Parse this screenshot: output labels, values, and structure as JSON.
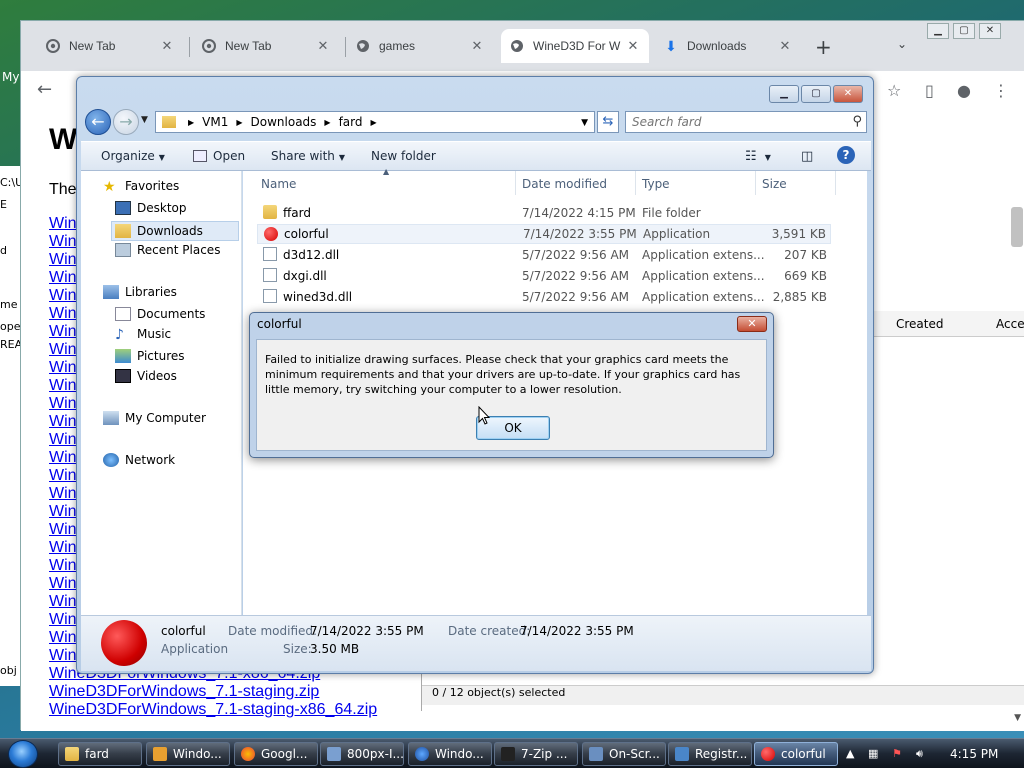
{
  "desktop": {
    "icon_label": "My",
    "left_strip": [
      "C:\\U",
      "E",
      "d",
      "me",
      "oper",
      "REA",
      "obj"
    ]
  },
  "chrome": {
    "tabs": [
      {
        "label": "New Tab",
        "icon": "chrome-icon"
      },
      {
        "label": "New Tab",
        "icon": "chrome-icon"
      },
      {
        "label": "games",
        "icon": "globe-icon"
      },
      {
        "label": "WineD3D For W",
        "icon": "globe-icon"
      },
      {
        "label": "Downloads",
        "icon": "download-icon"
      }
    ],
    "new_tab": "+",
    "page": {
      "heading": "W",
      "intro": "The",
      "links": [
        "Wine",
        "Wine",
        "Wine",
        "Wine",
        "Win",
        "Win",
        "Win",
        "Win",
        "Win",
        "Win",
        "Win",
        "Win",
        "Win",
        "Win",
        "Win",
        "Win",
        "Win",
        "Win",
        "Win",
        "Win",
        "Win",
        "Win",
        "Win",
        "Win",
        "Win"
      ],
      "full_links": [
        "WineD3DForWindows_7.1-x86_64.zip",
        "WineD3DForWindows_7.1-staging.zip",
        "WineD3DForWindows_7.1-staging-x86_64.zip"
      ]
    }
  },
  "zip": {
    "headers": [
      "Created",
      "Accessed"
    ],
    "status": "0 / 12 object(s) selected"
  },
  "explorer": {
    "breadcrumb": [
      "VM1",
      "Downloads",
      "fard"
    ],
    "search_placeholder": "Search fard",
    "commands": {
      "organize": "Organize",
      "open": "Open",
      "share": "Share with",
      "new_folder": "New folder"
    },
    "nav": {
      "favorites": "Favorites",
      "desktop": "Desktop",
      "downloads": "Downloads",
      "recent": "Recent Places",
      "libraries": "Libraries",
      "documents": "Documents",
      "music": "Music",
      "pictures": "Pictures",
      "videos": "Videos",
      "computer": "My Computer",
      "network": "Network"
    },
    "columns": {
      "name": "Name",
      "date": "Date modified",
      "type": "Type",
      "size": "Size"
    },
    "files": [
      {
        "name": "ffard",
        "date": "7/14/2022 4:15 PM",
        "type": "File folder",
        "size": "",
        "icon": "folder-icon"
      },
      {
        "name": "colorful",
        "date": "7/14/2022 3:55 PM",
        "type": "Application",
        "size": "3,591 KB",
        "icon": "red-circle-icon"
      },
      {
        "name": "d3d12.dll",
        "date": "5/7/2022 9:56 AM",
        "type": "Application extens...",
        "size": "207 KB",
        "icon": "dll-icon"
      },
      {
        "name": "dxgi.dll",
        "date": "5/7/2022 9:56 AM",
        "type": "Application extens...",
        "size": "669 KB",
        "icon": "dll-icon"
      },
      {
        "name": "wined3d.dll",
        "date": "5/7/2022 9:56 AM",
        "type": "Application extens...",
        "size": "2,885 KB",
        "icon": "dll-icon"
      }
    ],
    "details": {
      "name": "colorful",
      "kind": "Application",
      "modified_label": "Date modified:",
      "modified": "7/14/2022 3:55 PM",
      "created_label": "Date created:",
      "created": "7/14/2022 3:55 PM",
      "size_label": "Size:",
      "size": "3.50 MB"
    }
  },
  "dialog": {
    "title": "colorful",
    "message": "Failed to initialize drawing surfaces. Please check that your graphics card meets the minimum requirements and that your drivers are up-to-date. If your graphics card has little memory, try switching your computer to a lower resolution.",
    "ok": "OK",
    "close": "✕"
  },
  "taskbar": {
    "buttons": [
      "fard",
      "Windo...",
      "Googl...",
      "800px-I...",
      "Windo...",
      "7-Zip ...",
      "On-Scr...",
      "Registr...",
      "colorful"
    ],
    "clock": "4:15 PM"
  }
}
